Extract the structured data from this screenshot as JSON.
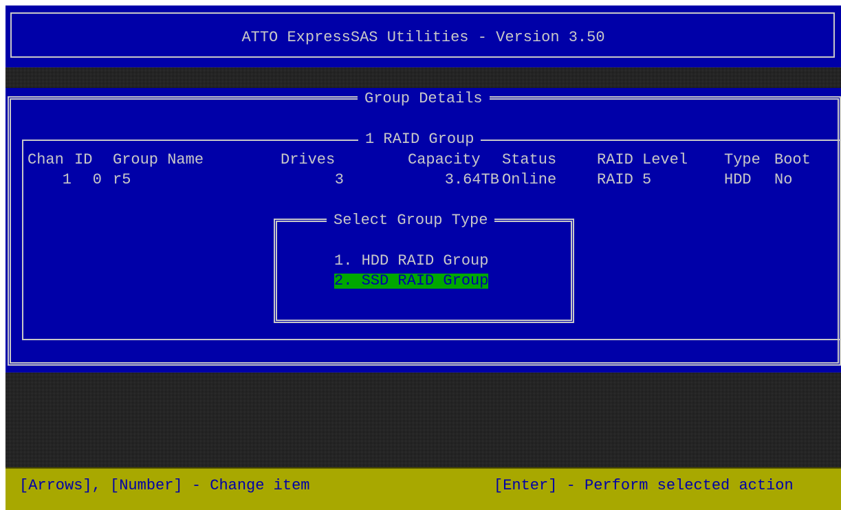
{
  "header": {
    "title": "ATTO ExpressSAS Utilities - Version 3.50"
  },
  "group_details": {
    "title": "Group Details",
    "raid_group_box": {
      "title": "1 RAID Group",
      "columns": {
        "chan": "Chan",
        "id": "ID",
        "group_name": "Group Name",
        "drives": "Drives",
        "capacity": "Capacity",
        "status": "Status",
        "raid_level": "RAID Level",
        "type": "Type",
        "boot": "Boot"
      },
      "rows": [
        {
          "chan": "1",
          "id": "0",
          "group_name": "r5",
          "drives": "3",
          "capacity": "3.64TB",
          "status": "Online",
          "raid_level": "RAID 5",
          "type": "HDD",
          "boot": "No"
        }
      ]
    }
  },
  "dialog": {
    "title": "Select Group Type",
    "options": [
      {
        "label": "1. HDD RAID Group",
        "selected": false
      },
      {
        "label": "2. SSD RAID Group",
        "selected": true
      }
    ]
  },
  "status_bar": {
    "left": "[Arrows], [Number] - Change item",
    "right": "[Enter] - Perform selected action"
  },
  "colors": {
    "panel_blue": "#0000a8",
    "text_gray": "#c8c8c8",
    "selection_green": "#00a800",
    "status_yellow": "#a8a800"
  }
}
